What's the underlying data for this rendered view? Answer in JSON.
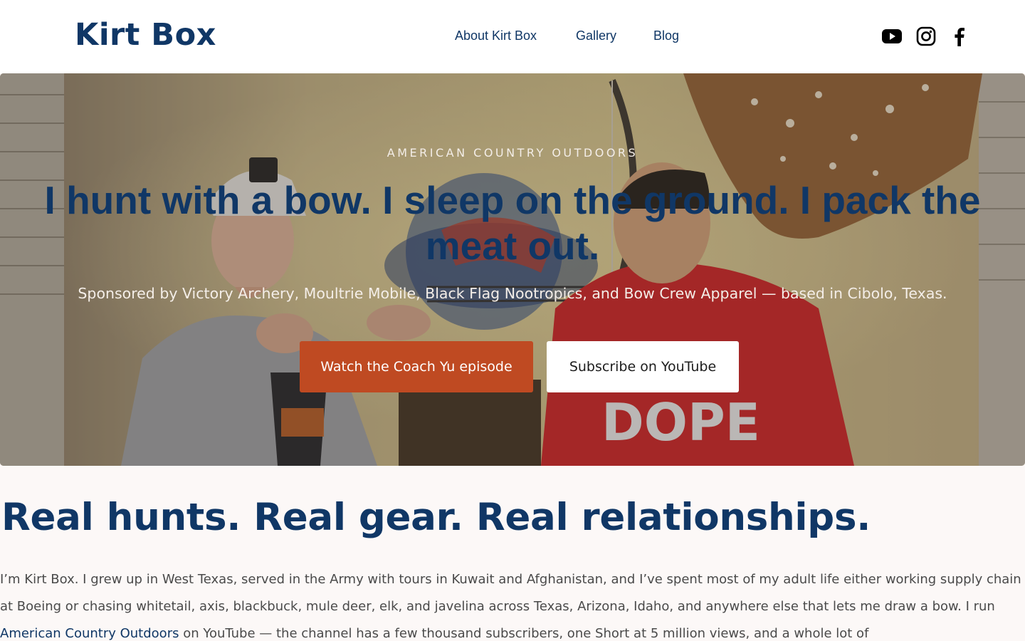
{
  "header": {
    "logo": "Kirt Box",
    "nav": [
      "About Kirt Box",
      "Gallery",
      "Blog"
    ],
    "social": [
      {
        "icon": "youtube-icon"
      },
      {
        "icon": "instagram-icon"
      },
      {
        "icon": "facebook-icon"
      }
    ]
  },
  "hero": {
    "eyebrow": "AMERICAN COUNTRY OUTDOORS",
    "headline": "I hunt with a bow. I sleep on the ground. I pack the meat out.",
    "subtitle": "Sponsored by Victory Archery, Moultrie Mobile, Black Flag Nootropics, and Bow Crew Apparel — based in Cibolo, Texas.",
    "primary_button": "Watch the Coach Yu episode",
    "secondary_button": "Subscribe on YouTube",
    "image_text": "DOPE"
  },
  "intro": {
    "heading": "Real hunts. Real gear. Real relationships.",
    "p_start": "I’m Kirt Box. I grew up in West Texas, served in the Army with tours in Kuwait and Afghanistan, and I’ve spent most of my adult life either working supply chain at Boeing or chasing whitetail, axis, blackbuck, mule deer, elk, and javelina across Texas, Arizona, Idaho, and anywhere else that lets me draw a bow. I run ",
    "p_link": "American Country Outdoors",
    "p_end": " on YouTube — the channel has a few thousand subscribers, one Short at 5 million views, and a whole lot of"
  },
  "colors": {
    "brand_navy": "#103766",
    "accent_orange": "#bf4a22",
    "page_bg": "#fcf8f7"
  }
}
